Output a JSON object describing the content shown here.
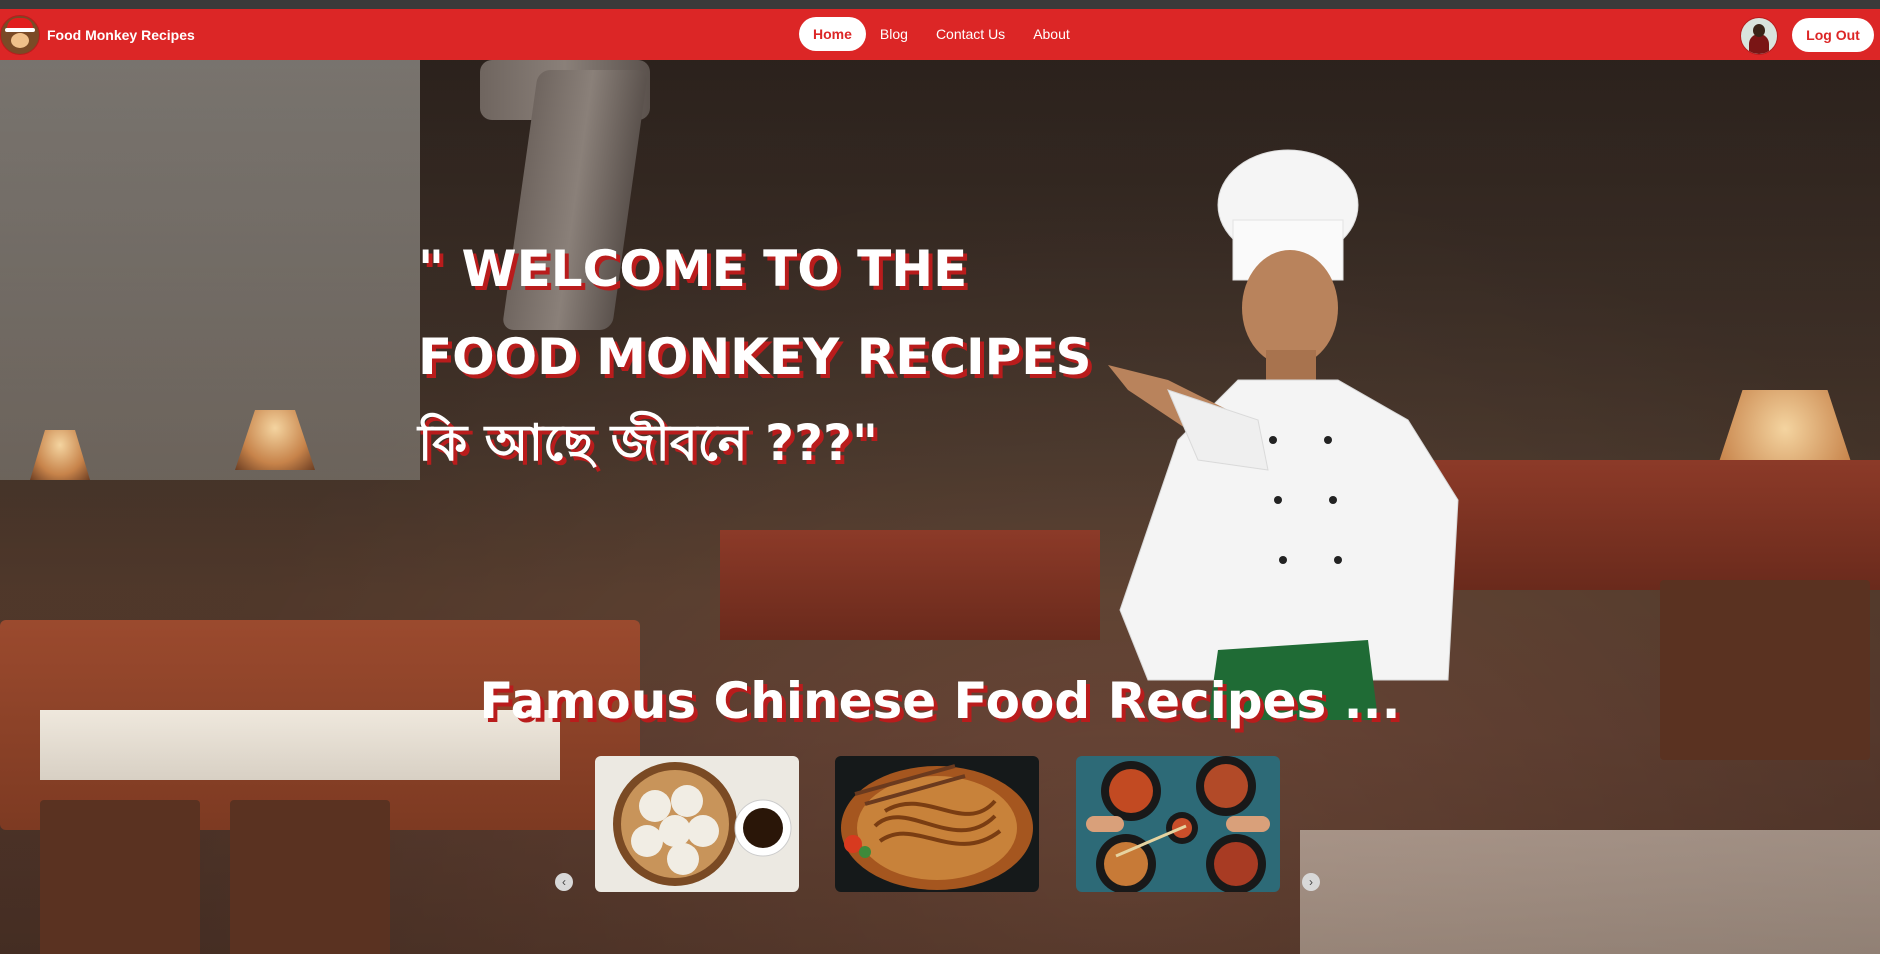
{
  "navbar": {
    "brand_name": "Food Monkey Recipes",
    "links": [
      "Home",
      "Blog",
      "Contact Us",
      "About"
    ],
    "active": "Home",
    "logout_label": "Log Out"
  },
  "hero": {
    "headline_line1": "\" WELCOME TO THE",
    "headline_line2": "FOOD MONKEY RECIPES",
    "headline_line3": "কি আছে জীবনে ???\""
  },
  "recipes": {
    "title": "Famous Chinese Food Recipes ...",
    "items": [
      {
        "icon": "dumplings-image"
      },
      {
        "icon": "noodles-image"
      },
      {
        "icon": "chinese-dishes-image"
      }
    ]
  },
  "colors": {
    "brand": "#dc2626",
    "text_shadow": "#b91c1c"
  }
}
